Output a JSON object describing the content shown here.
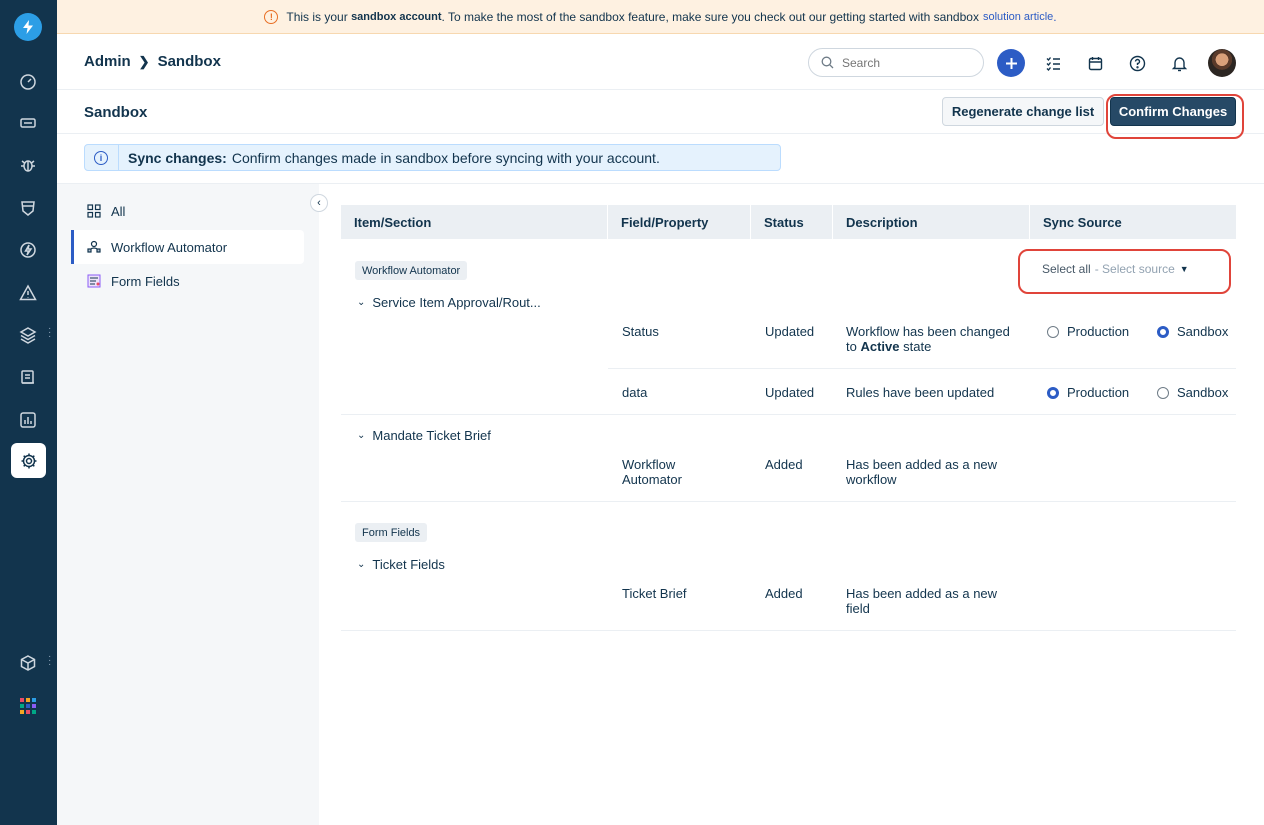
{
  "banner": {
    "prefix": "This is your",
    "bold": "sandbox account",
    "middle": ". To make the most of the sandbox feature, make sure you check out our getting started with sandbox",
    "link": "solution article",
    "suffix": "."
  },
  "header": {
    "breadcrumb": [
      "Admin",
      "Sandbox"
    ],
    "search_placeholder": "Search"
  },
  "page": {
    "title": "Sandbox",
    "regenerate_label": "Regenerate change list",
    "confirm_label": "Confirm Changes"
  },
  "info": {
    "bold": "Sync changes:",
    "text": "Confirm changes made in sandbox before syncing with your account."
  },
  "subnav": {
    "items": [
      {
        "label": "All",
        "icon": "grid-icon",
        "active": false
      },
      {
        "label": "Workflow Automator",
        "icon": "workflow-icon",
        "active": true
      },
      {
        "label": "Form Fields",
        "icon": "form-icon",
        "active": false
      }
    ]
  },
  "table": {
    "headers": [
      "Item/Section",
      "Field/Property",
      "Status",
      "Description",
      "Sync Source"
    ],
    "select_all": "Select all",
    "select_source": "- Select source",
    "sections": [
      {
        "tag": "Workflow Automator",
        "groups": [
          {
            "name": "Service Item Approval/Rout...",
            "rows": [
              {
                "field": "Status",
                "status": "Updated",
                "desc_1": "Workflow has been changed",
                "desc_2_prefix": "to",
                "desc_2_bold": "Active",
                "desc_2_suffix": "state",
                "production": "Production",
                "sandbox": "Sandbox",
                "selected": "sandbox"
              },
              {
                "field": "data",
                "status": "Updated",
                "desc_1": "Rules have been updated",
                "production": "Production",
                "sandbox": "Sandbox",
                "selected": "production"
              }
            ]
          },
          {
            "name": "Mandate Ticket Brief",
            "rows": [
              {
                "field_1": "Workflow",
                "field_2": "Automator",
                "status": "Added",
                "desc_1": "Has been added as a new",
                "desc_2": "workflow"
              }
            ]
          }
        ]
      },
      {
        "tag": "Form Fields",
        "groups": [
          {
            "name": "Ticket Fields",
            "rows": [
              {
                "field": "Ticket Brief",
                "status": "Added",
                "desc_1": "Has been added as a new",
                "desc_2": "field"
              }
            ]
          }
        ]
      }
    ]
  }
}
